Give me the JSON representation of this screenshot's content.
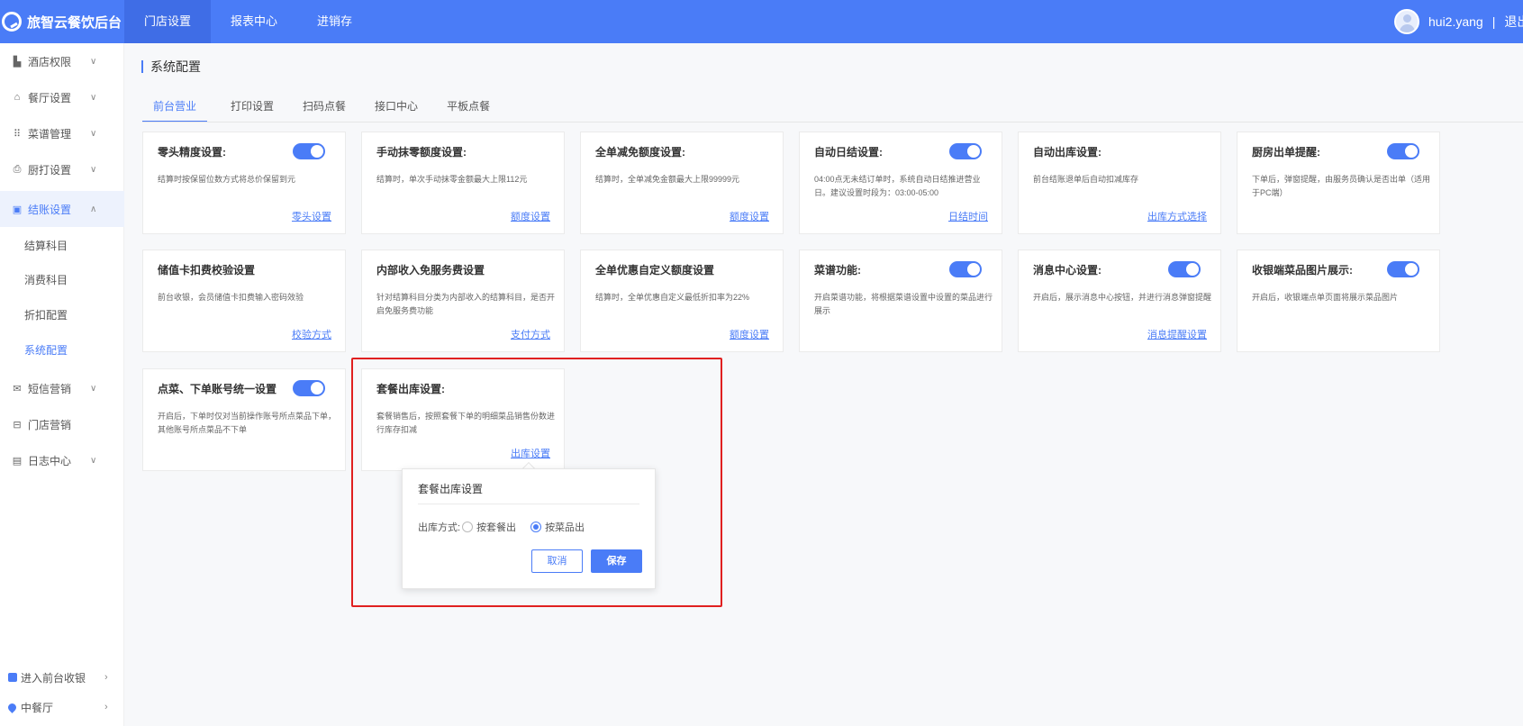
{
  "app": {
    "logo_text": "旅智云餐饮后台"
  },
  "topnav": [
    {
      "label": "门店设置",
      "active": true
    },
    {
      "label": "报表中心"
    },
    {
      "label": "进销存"
    }
  ],
  "user": {
    "name": "hui2.yang",
    "separator": "|",
    "logout": "退出"
  },
  "sidebar": {
    "items": [
      {
        "label": "酒店权限"
      },
      {
        "label": "餐厅设置"
      },
      {
        "label": "菜谱管理"
      },
      {
        "label": "厨打设置"
      },
      {
        "label": "结账设置"
      }
    ],
    "sub_items": [
      {
        "label": "结算科目"
      },
      {
        "label": "消费科目"
      },
      {
        "label": "折扣配置"
      },
      {
        "label": "系统配置",
        "active": true
      }
    ],
    "items_after": [
      {
        "label": "短信营销"
      },
      {
        "label": "门店营销"
      },
      {
        "label": "日志中心"
      }
    ],
    "footer": [
      {
        "label": "进入前台收银"
      },
      {
        "label": "中餐厅"
      }
    ]
  },
  "page": {
    "title": "系统配置"
  },
  "tabs": [
    {
      "label": "前台营业",
      "active": true
    },
    {
      "label": "打印设置"
    },
    {
      "label": "扫码点餐"
    },
    {
      "label": "接口中心"
    },
    {
      "label": "平板点餐"
    }
  ],
  "cards": [
    {
      "title": "零头精度设置:",
      "desc": "结算时按保留位数方式将总价保留到元",
      "link": "零头设置",
      "toggle": true
    },
    {
      "title": "手动抹零额度设置:",
      "desc": "结算时，单次手动抹零金额最大上限112元",
      "link": "额度设置",
      "toggle": false
    },
    {
      "title": "全单减免额度设置:",
      "desc": "结算时，全单减免金额最大上限99999元",
      "link": "额度设置",
      "toggle": false
    },
    {
      "title": "自动日结设置:",
      "desc": "04:00点无未结订单时，系统自动日结推进营业日。建议设置时段为：03:00-05:00",
      "link": "日结时间",
      "toggle": true
    },
    {
      "title": "自动出库设置:",
      "desc": "前台结账退单后自动扣减库存",
      "link": "出库方式选择",
      "toggle": false
    },
    {
      "title": "厨房出单提醒:",
      "desc": "下单后，弹窗提醒，由服务员确认是否出单（适用于PC端）",
      "link": "",
      "toggle": true
    },
    {
      "title": "储值卡扣费校验设置",
      "desc": "前台收银，会员储值卡扣费输入密码效验",
      "link": "校验方式",
      "toggle": false
    },
    {
      "title": "内部收入免服务费设置",
      "desc": "针对结算科目分类为内部收入的结算科目，是否开启免服务费功能",
      "link": "支付方式",
      "toggle": false
    },
    {
      "title": "全单优惠自定义额度设置",
      "desc": "结算时，全单优惠自定义最低折扣率为22%",
      "link": "额度设置",
      "toggle": false
    },
    {
      "title": "菜谱功能:",
      "desc": "开启菜谱功能，将根据菜谱设置中设置的菜品进行展示",
      "link": "",
      "toggle": true
    },
    {
      "title": "消息中心设置:",
      "desc": "开启后，展示消息中心按钮，并进行消息弹窗提醒",
      "link": "消息提醒设置",
      "toggle": true
    },
    {
      "title": "收银端菜品图片展示:",
      "desc": "开启后，收银端点单页面将展示菜品图片",
      "link": "",
      "toggle": true
    },
    {
      "title": "点菜、下单账号统一设置",
      "desc": "开启后，下单时仅对当前操作账号所点菜品下单，其他账号所点菜品不下单",
      "link": "",
      "toggle": true
    },
    {
      "title": "套餐出库设置:",
      "desc": "套餐销售后，按照套餐下单的明细菜品销售份数进行库存扣减",
      "link": "出库设置",
      "toggle": false
    }
  ],
  "popover": {
    "title": "套餐出库设置",
    "field_label": "出库方式:",
    "options": [
      {
        "label": "按套餐出",
        "checked": false
      },
      {
        "label": "按菜品出",
        "checked": true
      }
    ],
    "cancel": "取消",
    "save": "保存"
  },
  "colors": {
    "primary": "#4a7cf7",
    "highlight": "#e02020"
  }
}
